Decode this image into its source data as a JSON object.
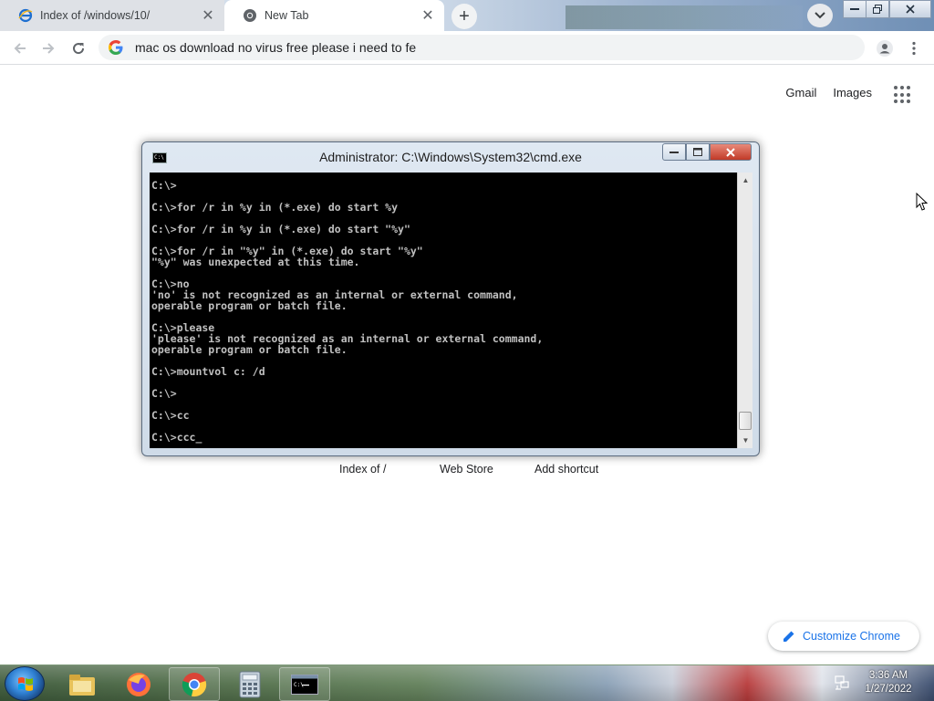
{
  "tabs": [
    {
      "title": "Index of /windows/10/",
      "favicon": "ie-icon",
      "active": false
    },
    {
      "title": "New Tab",
      "favicon": "chrome-icon",
      "active": true
    }
  ],
  "toolbar": {
    "omnibox_value": "mac os download no virus free please i need to fe"
  },
  "ntp": {
    "gmail": "Gmail",
    "images": "Images",
    "shortcuts": [
      "Index of /",
      "Web Store",
      "Add shortcut"
    ],
    "customize": "Customize Chrome"
  },
  "cmd": {
    "title": "Administrator: C:\\Windows\\System32\\cmd.exe",
    "lines": [
      "C:\\>",
      "",
      "C:\\>for /r in %y in (*.exe) do start %y",
      "",
      "C:\\>for /r in %y in (*.exe) do start \"%y\"",
      "",
      "C:\\>for /r in \"%y\" in (*.exe) do start \"%y\"",
      "\"%y\" was unexpected at this time.",
      "",
      "C:\\>no",
      "'no' is not recognized as an internal or external command,",
      "operable program or batch file.",
      "",
      "C:\\>please",
      "'please' is not recognized as an internal or external command,",
      "operable program or batch file.",
      "",
      "C:\\>mountvol c: /d",
      "",
      "C:\\>",
      "",
      "C:\\>cc",
      "",
      "C:\\>ccc_"
    ]
  },
  "taskbar": {
    "items": [
      "windows-explorer-icon",
      "firefox-icon",
      "chrome-icon",
      "calculator-icon",
      "cmd-icon"
    ],
    "time": "3:36 AM",
    "date": "1/27/2022"
  }
}
